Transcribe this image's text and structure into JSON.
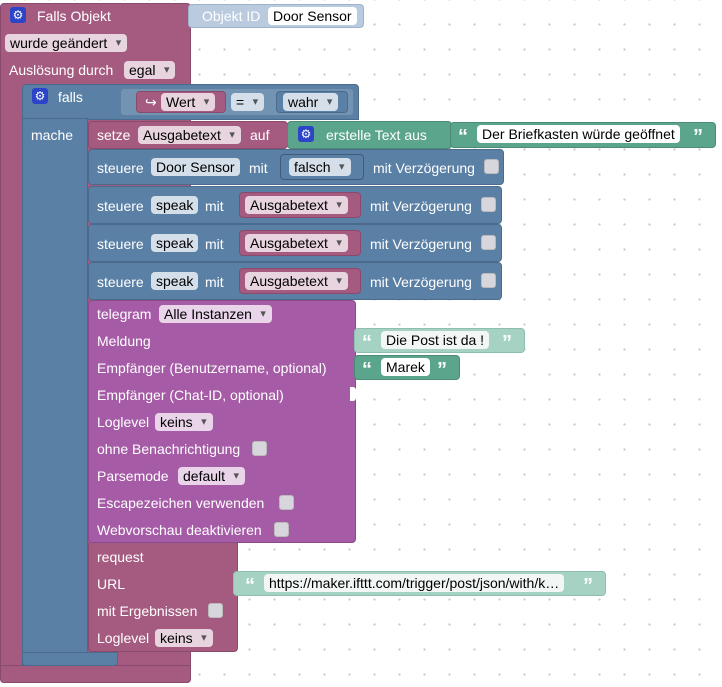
{
  "trigger": {
    "title": "Falls Objekt",
    "object_id_label": "Objekt ID",
    "object_id_value": "Door Sensor",
    "condition": "wurde geändert",
    "trigger_by_label": "Auslösung durch",
    "trigger_by_value": "egal"
  },
  "if_block": {
    "if_label": "falls",
    "do_label": "mache",
    "condition": {
      "variable": "Wert",
      "operator": "=",
      "value": "wahr"
    }
  },
  "set_block": {
    "label": "setze",
    "variable": "Ausgabetext",
    "to_label": "auf",
    "text_join_label": "erstelle Text aus",
    "text_value": "Der Briefkasten würde geöffnet"
  },
  "control_blocks": [
    {
      "label": "steuere",
      "target": "Door Sensor",
      "with_label": "mit",
      "value": "falsch",
      "delay_label": "mit Verzögerung"
    },
    {
      "label": "steuere",
      "target": "speak",
      "with_label": "mit",
      "value": "Ausgabetext",
      "delay_label": "mit Verzögerung"
    },
    {
      "label": "steuere",
      "target": "speak",
      "with_label": "mit",
      "value": "Ausgabetext",
      "delay_label": "mit Verzögerung"
    },
    {
      "label": "steuere",
      "target": "speak",
      "with_label": "mit",
      "value": "Ausgabetext",
      "delay_label": "mit Verzögerung"
    }
  ],
  "telegram": {
    "label": "telegram",
    "instance": "Alle Instanzen",
    "message_label": "Meldung",
    "message_value": "Die Post ist da !",
    "recipient_user_label": "Empfänger (Benutzername, optional)",
    "recipient_user_value": "Marek",
    "recipient_chat_label": "Empfänger (Chat-ID, optional)",
    "loglevel_label": "Loglevel",
    "loglevel_value": "keins",
    "no_notification_label": "ohne Benachrichtigung",
    "parsemode_label": "Parsemode",
    "parsemode_value": "default",
    "escape_label": "Escapezeichen verwenden",
    "webpreview_label": "Webvorschau deaktivieren"
  },
  "request": {
    "label": "request",
    "url_label": "URL",
    "url_value": "https://maker.ifttt.com/trigger/post/json/with/k…",
    "with_results_label": "mit Ergebnissen",
    "loglevel_label": "Loglevel",
    "loglevel_value": "keins"
  }
}
